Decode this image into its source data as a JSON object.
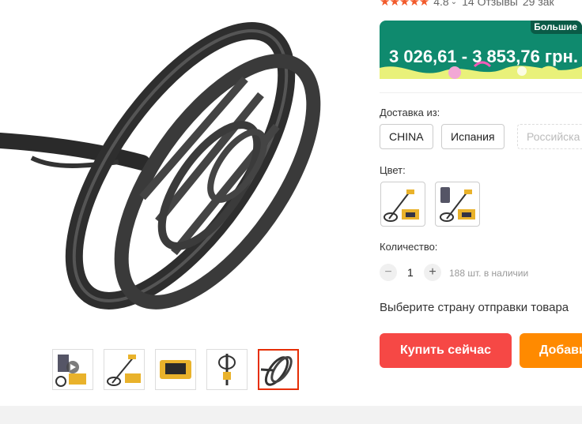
{
  "rating": {
    "stars": 4.8,
    "score_text": "4.8",
    "reviews": "14 Отзывы",
    "orders": "29 зак"
  },
  "price": {
    "badge": "Большие",
    "range": "3 026,61 - 3 853,76 грн."
  },
  "shipping": {
    "label": "Доставка из:",
    "options": [
      "CHINA",
      "Испания",
      "Российска"
    ]
  },
  "color": {
    "label": "Цвет:"
  },
  "quantity": {
    "label": "Количество:",
    "value": "1",
    "stock": "188 шт. в наличии",
    "minus": "−",
    "plus": "+"
  },
  "ship_hint": "Выберите страну отправки товара",
  "actions": {
    "buy_now": "Купить сейчас",
    "add_to_cart": "Добавить"
  },
  "colors": {
    "accent_red": "#f64845",
    "accent_orange": "#ff8a00",
    "price_green": "#0f8a6e"
  }
}
